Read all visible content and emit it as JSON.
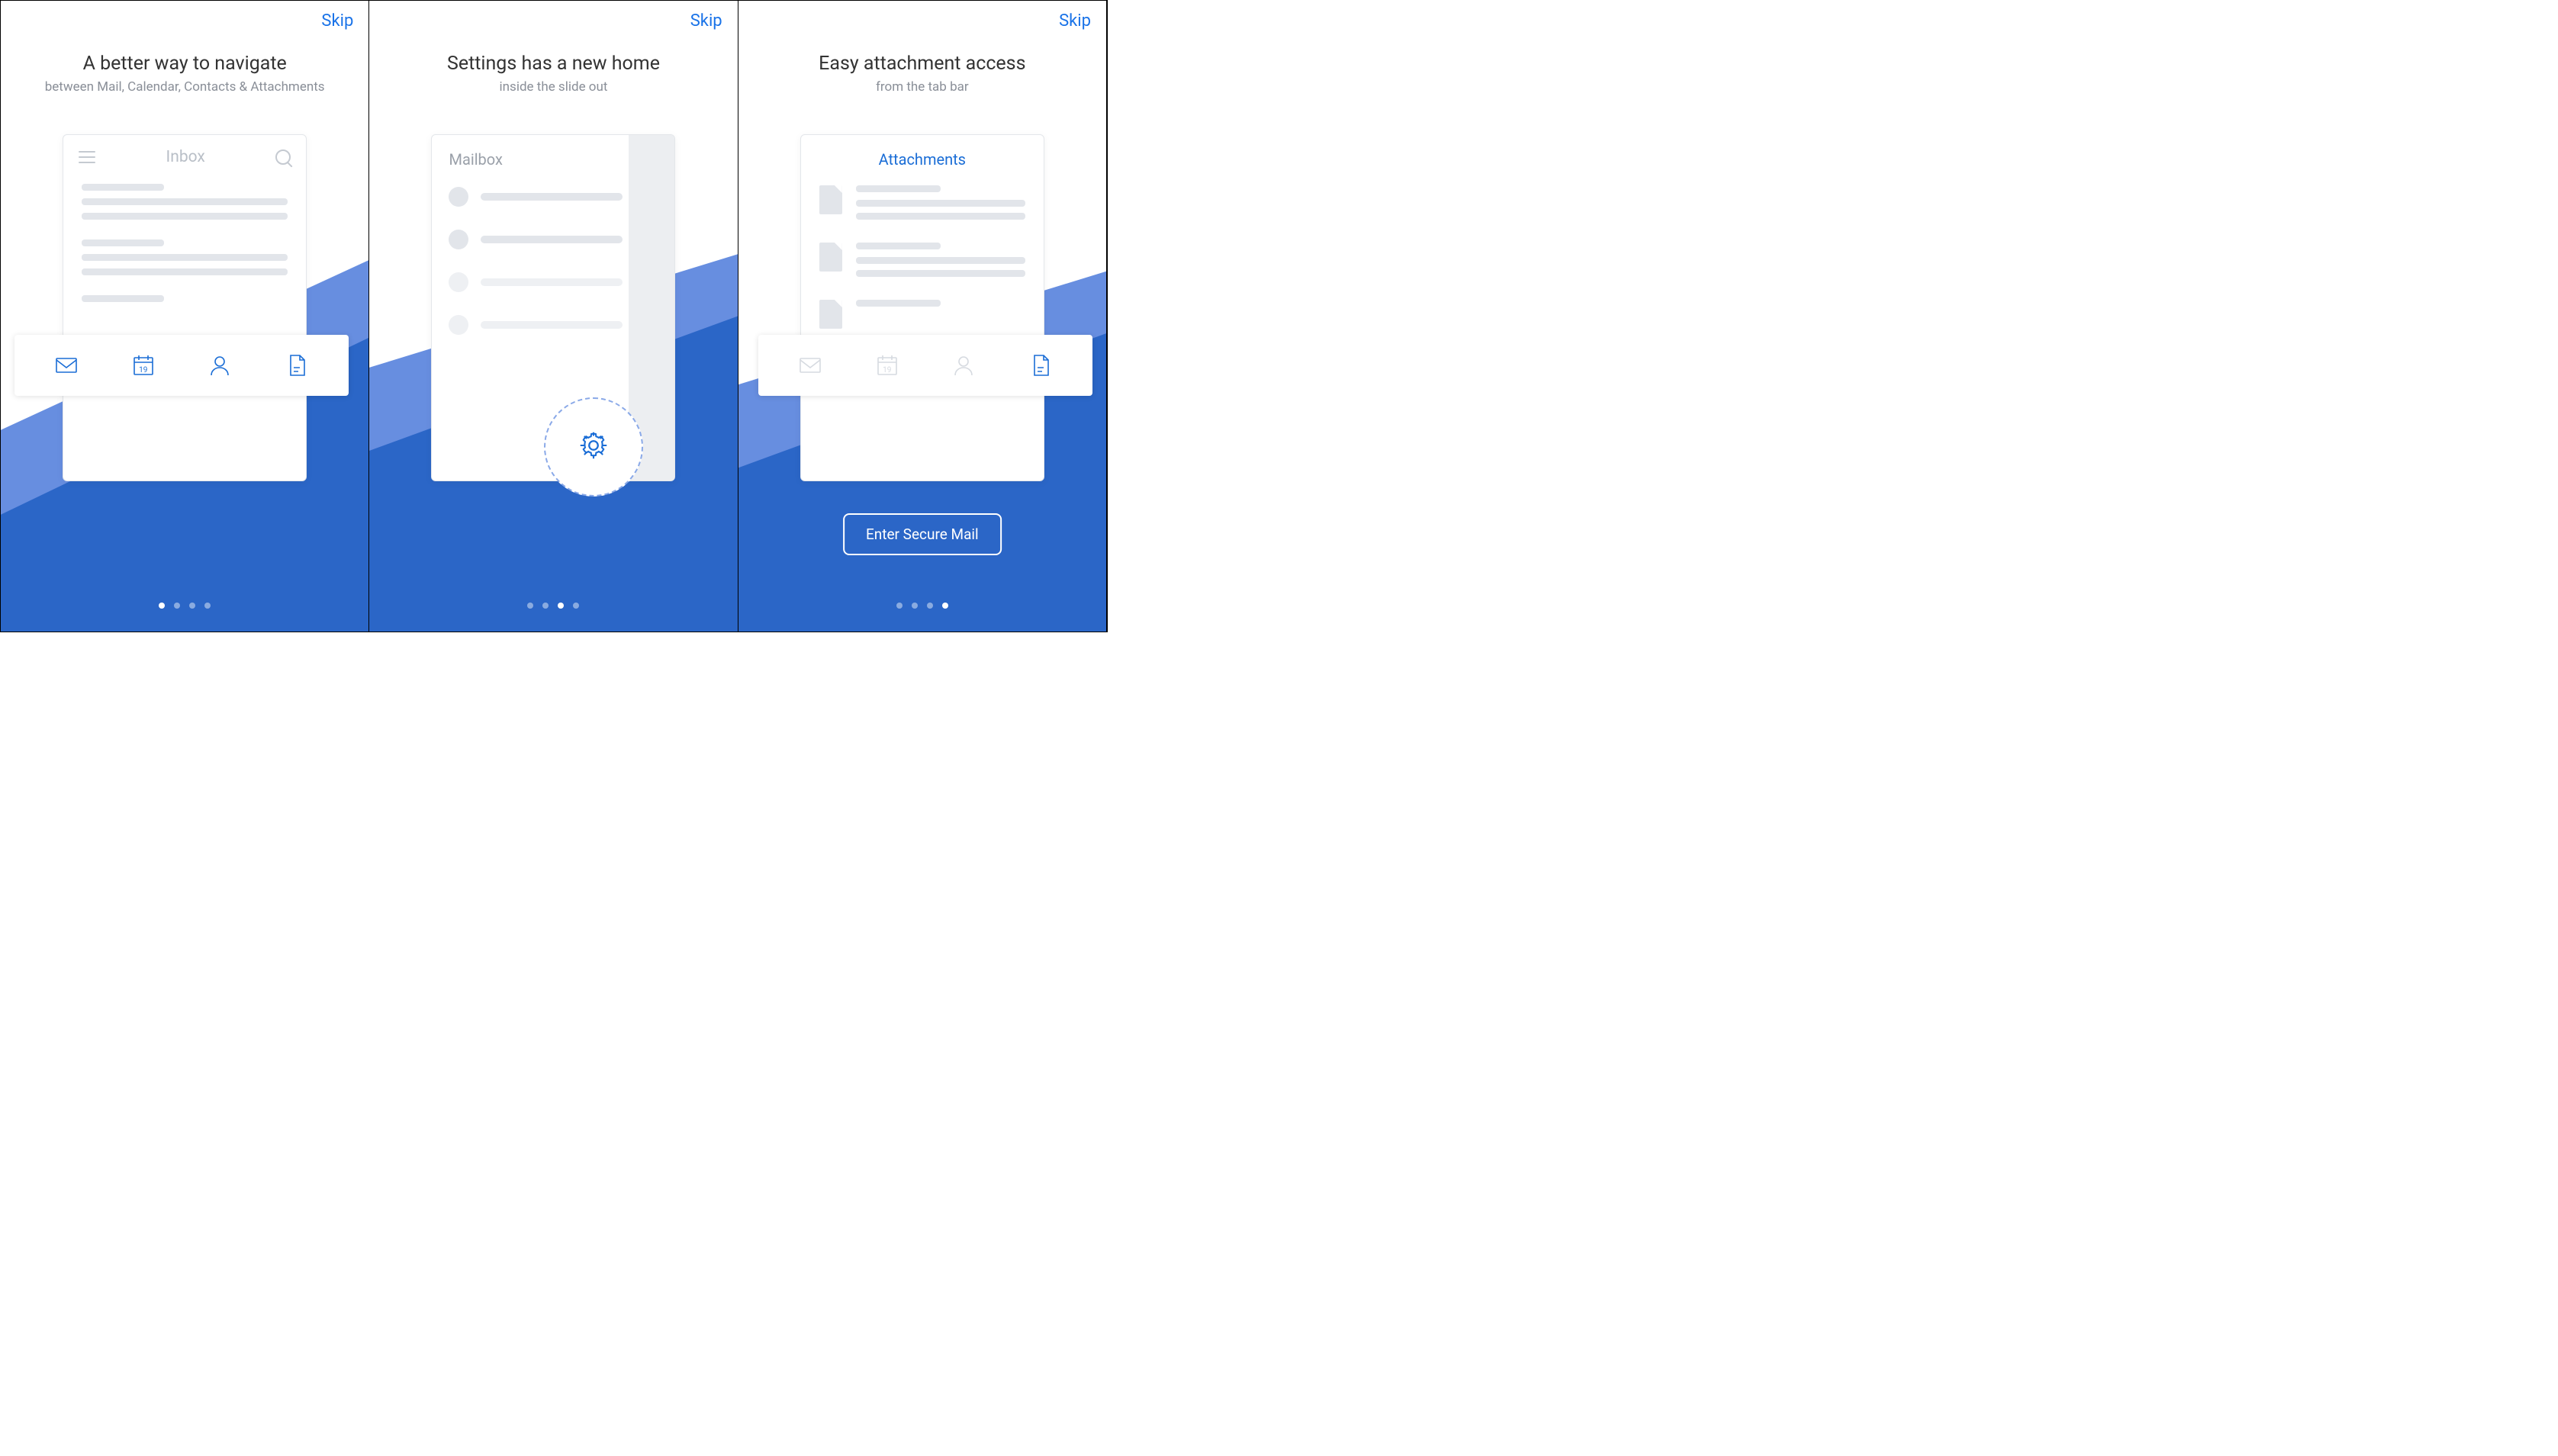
{
  "panels": [
    {
      "skip": "Skip",
      "title": "A better way to navigate",
      "subtitle": "between Mail, Calendar, Contacts & Attachments",
      "mock_header": "Inbox",
      "calendar_day": "19",
      "page_index": 0
    },
    {
      "skip": "Skip",
      "title": "Settings has a new home",
      "subtitle": "inside the slide out",
      "mailbox_label": "Mailbox",
      "page_index": 2
    },
    {
      "skip": "Skip",
      "title": "Easy attachment access",
      "subtitle": "from the tab bar",
      "attachments_label": "Attachments",
      "calendar_day": "19",
      "enter_button": "Enter Secure Mail",
      "page_index": 3
    }
  ],
  "page_count": 4,
  "icons": {
    "mail": "mail-icon",
    "calendar": "calendar-icon",
    "contacts": "contacts-icon",
    "attachments": "attachments-file-icon",
    "settings": "gear-icon",
    "menu": "hamburger-icon",
    "search": "search-icon"
  }
}
